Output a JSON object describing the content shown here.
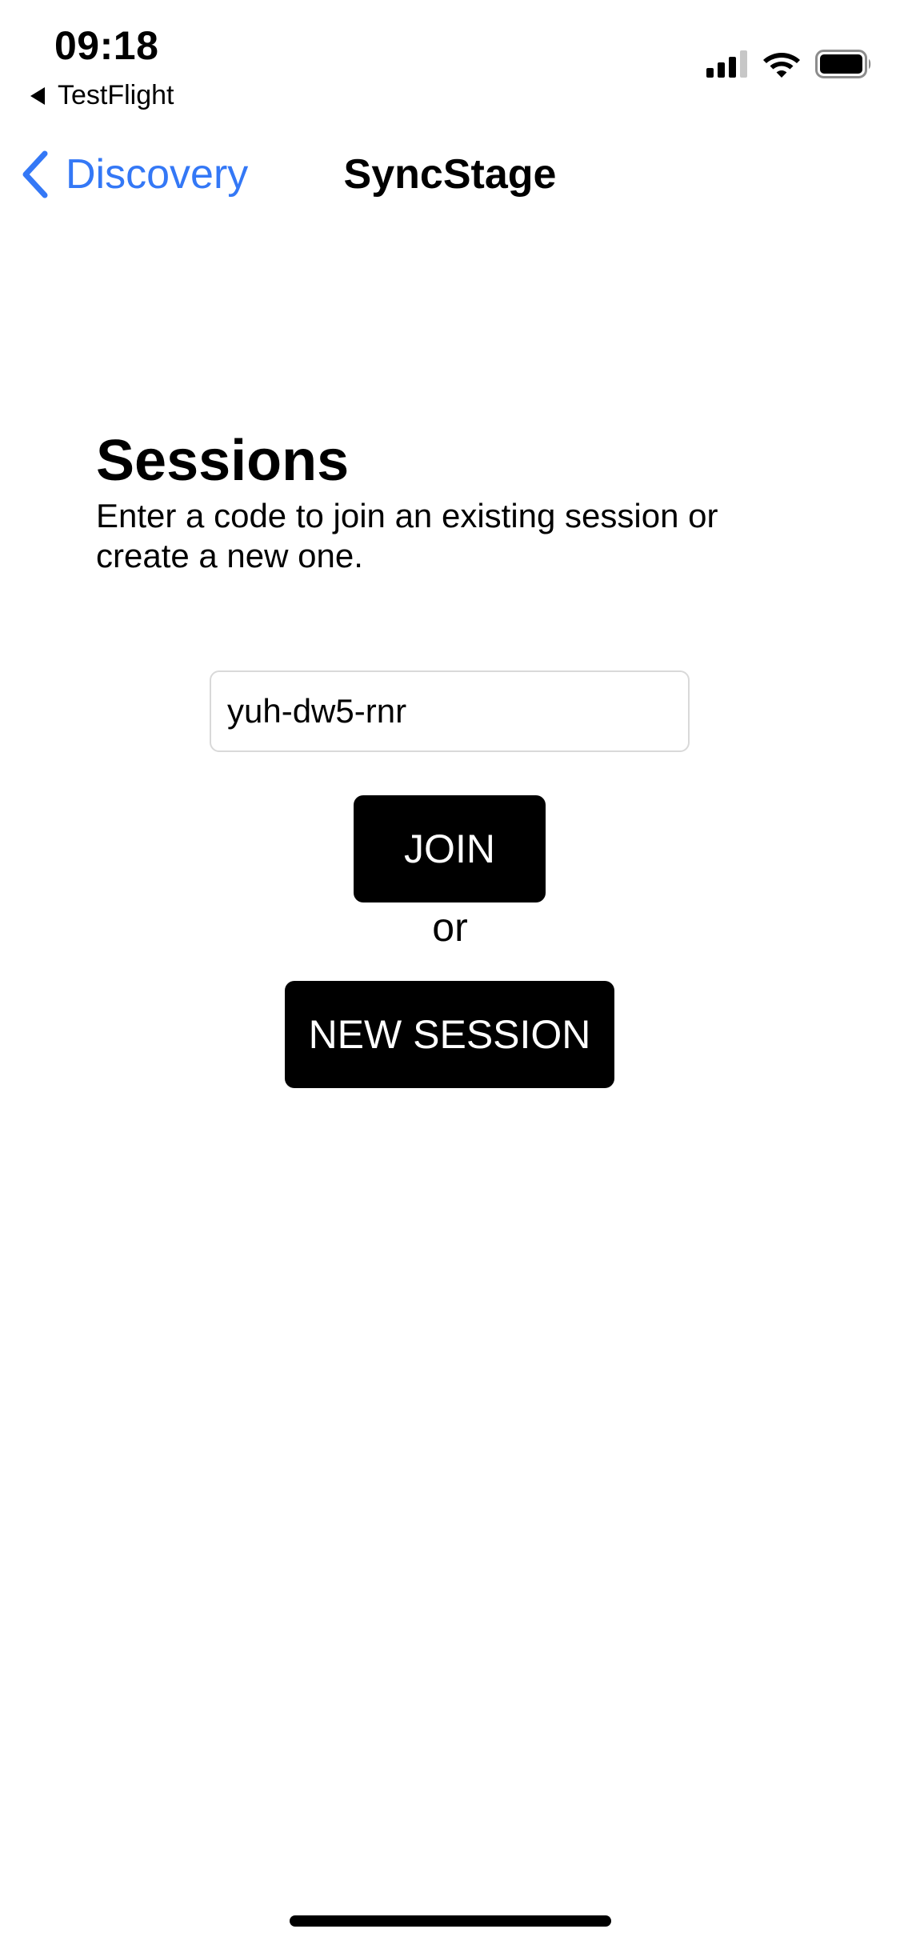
{
  "status_bar": {
    "time": "09:18",
    "back_app": "TestFlight",
    "icons": [
      "cellular-signal-icon",
      "wifi-icon",
      "battery-icon"
    ]
  },
  "nav": {
    "back_label": "Discovery",
    "title": "SyncStage"
  },
  "sessions": {
    "heading": "Sessions",
    "description": "Enter a code to join an existing session or create a new one.",
    "code_value": "yuh-dw5-rnr",
    "join_label": "JOIN",
    "or_label": "or",
    "new_session_label": "NEW SESSION"
  },
  "colors": {
    "accent": "#3478f6",
    "button_bg": "#000000",
    "button_text": "#ffffff",
    "input_border": "#d9d9d9"
  }
}
